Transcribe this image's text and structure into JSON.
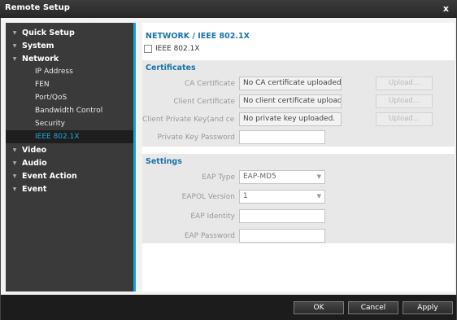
{
  "window": {
    "title": "Remote Setup",
    "close_glyph": "x"
  },
  "sidebar": {
    "sections": [
      {
        "label": "Quick Setup",
        "items": []
      },
      {
        "label": "System",
        "items": []
      },
      {
        "label": "Network",
        "items": [
          "IP Address",
          "FEN",
          "Port/QoS",
          "Bandwidth Control",
          "Security",
          "IEEE 802.1X"
        ]
      },
      {
        "label": "Video",
        "items": []
      },
      {
        "label": "Audio",
        "items": []
      },
      {
        "label": "Event Action",
        "items": []
      },
      {
        "label": "Event",
        "items": []
      }
    ],
    "active_item": "IEEE 802.1X"
  },
  "content": {
    "heading": "NETWORK / IEEE 802.1X",
    "enable_label": "IEEE 802.1X",
    "enable_checked": false,
    "certificates": {
      "title": "Certificates",
      "ca_label": "CA Certificate",
      "ca_value": "No CA certificate uploaded.",
      "client_label": "Client Certificate",
      "client_value": "No client certificate uploaded.",
      "private_key_label": "Client Private Key(and ce...",
      "private_key_value": "No private key uploaded.",
      "key_password_label": "Private Key Password",
      "key_password_value": "",
      "upload_label": "Upload..."
    },
    "settings": {
      "title": "Settings",
      "eap_type_label": "EAP Type",
      "eap_type_value": "EAP-MD5",
      "eapol_version_label": "EAPOL Version",
      "eapol_version_value": "1",
      "eap_identity_label": "EAP Identity",
      "eap_identity_value": "",
      "eap_password_label": "EAP Password",
      "eap_password_value": ""
    }
  },
  "footer": {
    "ok_label": "OK",
    "cancel_label": "Cancel",
    "apply_label": "Apply"
  },
  "colors": {
    "accent": "#1a9fd4",
    "heading": "#1a73a8",
    "sidebar_bg": "#3a3a3a",
    "active_item_text": "#1fa8de"
  },
  "icons": {
    "expand_arrow": "triangle-down-icon",
    "select_caret": "chevron-down-icon"
  }
}
